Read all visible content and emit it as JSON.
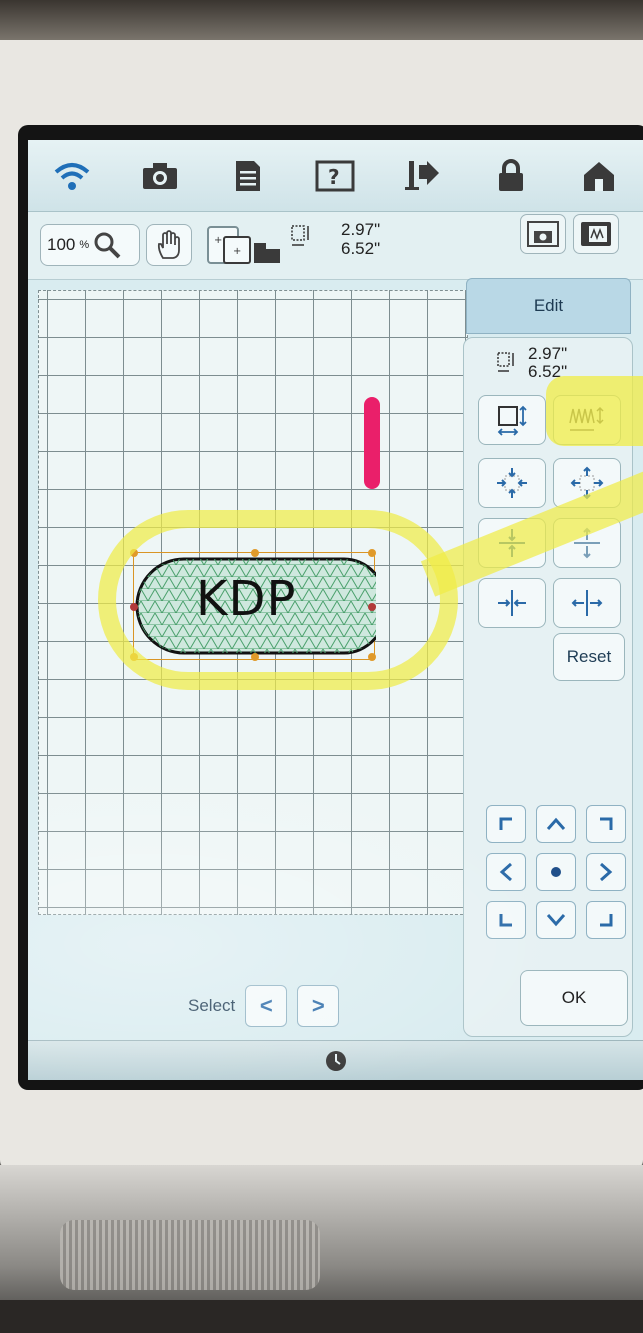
{
  "toolbar": {
    "zoom_value": "100",
    "zoom_unit": "%",
    "design_width": "2.97\"",
    "design_height": "6.52\""
  },
  "edit_panel": {
    "tab_label": "Edit",
    "width": "2.97\"",
    "height": "6.52\"",
    "reset_label": "Reset",
    "ok_label": "OK"
  },
  "design": {
    "text": "KDP"
  },
  "footer": {
    "select_label": "Select",
    "prev": "<",
    "next": ">"
  },
  "colors": {
    "highlight": "#f0ec46",
    "pen_mark": "#ea1f6a",
    "selection": "#d99525"
  }
}
